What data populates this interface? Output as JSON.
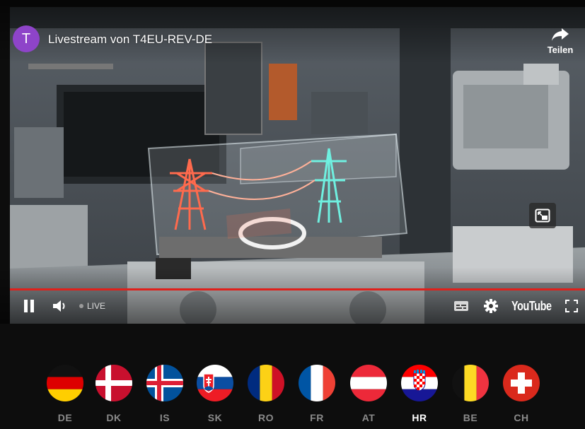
{
  "player": {
    "channel_initial": "T",
    "title": "Livestream von T4EU-REV-DE",
    "share_label": "Teilen",
    "live_label": "LIVE",
    "brand_label": "YouTube",
    "progress_color": "#e0201b",
    "icons": {
      "avatar": "channel-avatar",
      "share": "share-arrow-icon",
      "miniplayer": "miniplayer-icon",
      "play_pause": "pause-icon",
      "volume": "volume-icon",
      "subtitles": "subtitles-icon",
      "settings": "gear-icon",
      "fullscreen": "fullscreen-icon"
    }
  },
  "flags": [
    {
      "code": "DE",
      "country": "germany",
      "active": false
    },
    {
      "code": "DK",
      "country": "denmark",
      "active": false
    },
    {
      "code": "IS",
      "country": "iceland",
      "active": false
    },
    {
      "code": "SK",
      "country": "slovakia",
      "active": false
    },
    {
      "code": "RO",
      "country": "romania",
      "active": false
    },
    {
      "code": "FR",
      "country": "france",
      "active": false
    },
    {
      "code": "AT",
      "country": "austria",
      "active": false
    },
    {
      "code": "HR",
      "country": "croatia",
      "active": true
    },
    {
      "code": "BE",
      "country": "belgium",
      "active": false
    },
    {
      "code": "CH",
      "country": "switzerland",
      "active": false
    }
  ]
}
